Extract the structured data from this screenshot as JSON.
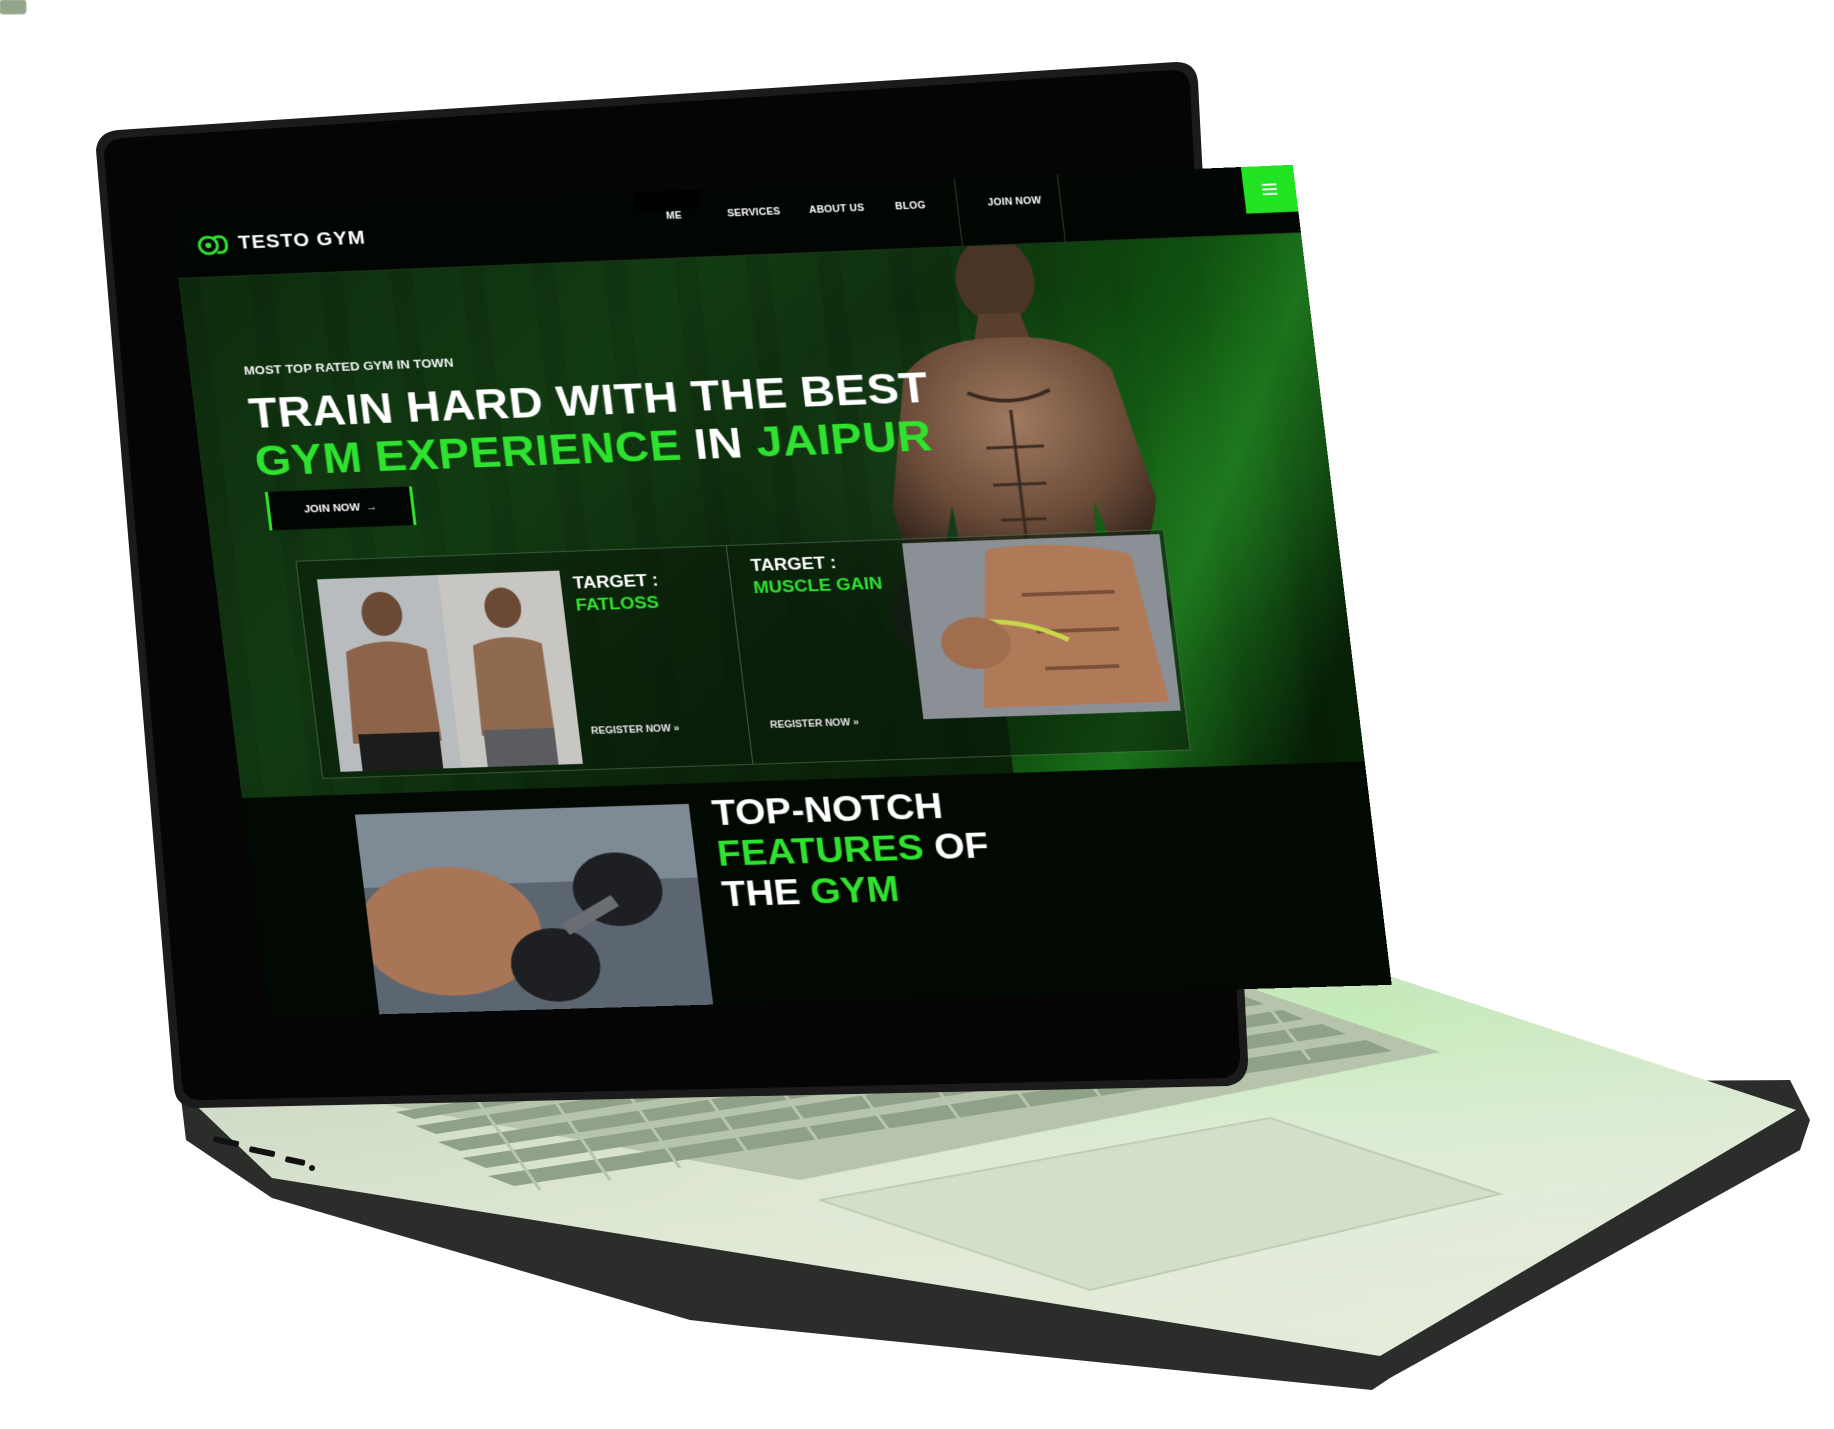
{
  "brand": {
    "name": "TESTO GYM"
  },
  "nav": {
    "items": [
      "ME",
      "SERVICES",
      "ABOUT US",
      "BLOG"
    ],
    "cta": "JOIN NOW",
    "menu_icon": "hamburger-icon"
  },
  "hero": {
    "kicker": "MOST TOP RATED GYM IN TOWN",
    "headline_line1": "TRAIN HARD WITH THE BEST",
    "headline_green1": "GYM EXPERIENCE",
    "headline_mid": " IN ",
    "headline_green2": "JAIPUR",
    "join_button": "JOIN NOW",
    "join_arrow": "→"
  },
  "cards": [
    {
      "label": "TARGET :",
      "goal": "FATLOSS",
      "link": "REGISTER NOW",
      "link_icon": "»"
    },
    {
      "label": "TARGET :",
      "goal": "MUSCLE GAIN",
      "link": "REGISTER NOW",
      "link_icon": "»"
    }
  ],
  "features": {
    "line1": "TOP-NOTCH",
    "line2_green": "FEATURES",
    "line2_white": " OF",
    "line3_white": "THE ",
    "line3_green": "GYM"
  },
  "colors": {
    "accent": "#2fe22f",
    "dark": "#020602",
    "deck": "#dfe9d6"
  }
}
